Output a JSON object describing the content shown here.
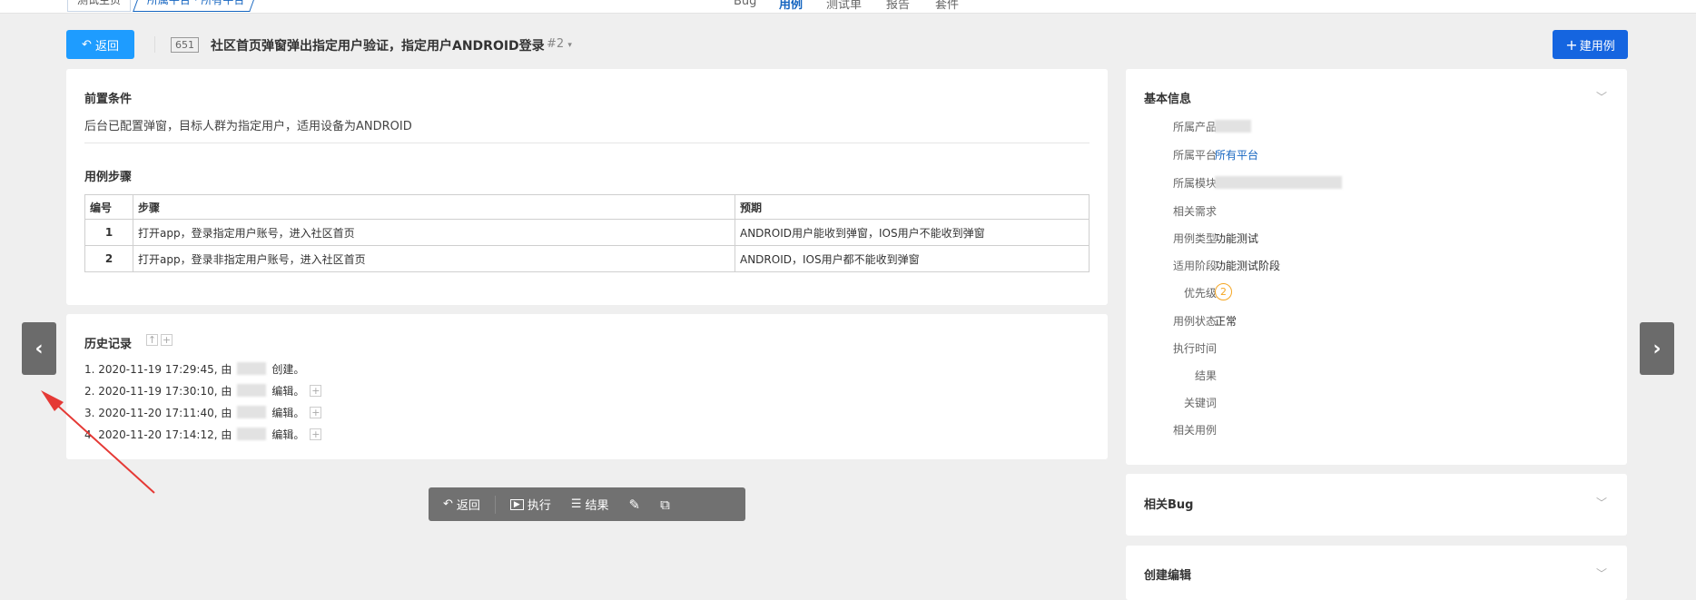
{
  "top_nav": {
    "crumb_home": "测试主页",
    "crumb_platform": "所属平台 · 所有平台",
    "tabs": [
      "Bug",
      "用例",
      "测试单",
      "报告",
      "套件"
    ]
  },
  "header": {
    "back_label": "返回",
    "case_id": "651",
    "case_title": "社区首页弹窗弹出指定用户验证，指定用户ANDROID登录",
    "version": "#2",
    "new_case_label": "建用例"
  },
  "precondition": {
    "title": "前置条件",
    "text": "后台已配置弹窗，目标人群为指定用户，适用设备为ANDROID"
  },
  "steps": {
    "title": "用例步骤",
    "headers": [
      "编号",
      "步骤",
      "预期"
    ],
    "rows": [
      {
        "no": "1",
        "step": "打开app，登录指定用户账号，进入社区首页",
        "expect": "ANDROID用户能收到弹窗，IOS用户不能收到弹窗"
      },
      {
        "no": "2",
        "step": "打开app，登录非指定用户账号，进入社区首页",
        "expect": "ANDROID，IOS用户都不能收到弹窗"
      }
    ]
  },
  "history": {
    "title": "历史记录",
    "items": [
      {
        "prefix": "1. 2020-11-19 17:29:45, 由",
        "suffix": "创建。"
      },
      {
        "prefix": "2. 2020-11-19 17:30:10, 由",
        "suffix": "编辑。"
      },
      {
        "prefix": "3. 2020-11-20 17:11:40, 由",
        "suffix": "编辑。"
      },
      {
        "prefix": "4. 2020-11-20 17:14:12, 由",
        "suffix": "编辑。"
      }
    ]
  },
  "toolbar": {
    "back": "返回",
    "run": "执行",
    "result": "结果"
  },
  "basic_info": {
    "title": "基本信息",
    "labels": {
      "product": "所属产品",
      "platform": "所属平台",
      "module": "所属模块",
      "story": "相关需求",
      "type": "用例类型",
      "stage": "适用阶段",
      "priority": "优先级",
      "status": "用例状态",
      "exec_time": "执行时间",
      "result": "结果",
      "keywords": "关键词",
      "related": "相关用例"
    },
    "values": {
      "platform": "所有平台",
      "type": "功能测试",
      "stage": "功能测试阶段",
      "priority": "2",
      "status": "正常"
    }
  },
  "related_bug": {
    "title": "相关Bug"
  },
  "create_edit": {
    "title": "创建编辑"
  },
  "colors": {
    "primary": "#1565e0",
    "back_button": "#1e9cff",
    "priority": "#f5a623",
    "annotation_arrow": "#e53935"
  }
}
